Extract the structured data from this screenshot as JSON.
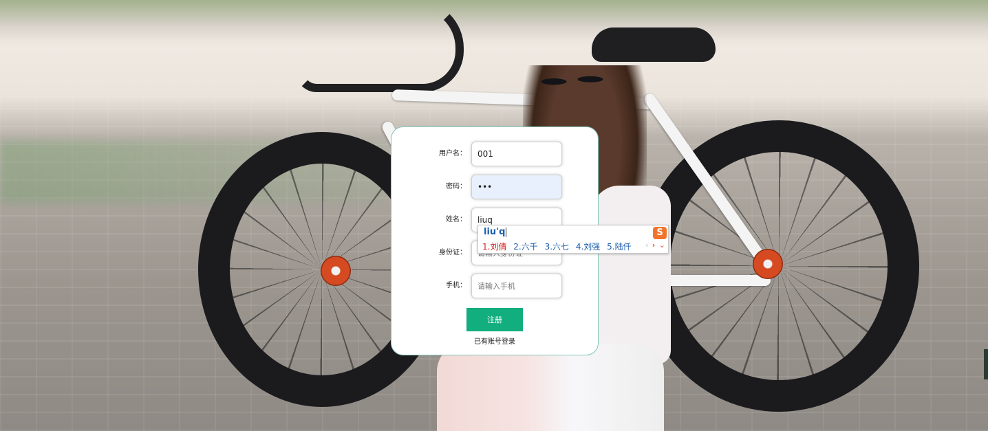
{
  "form": {
    "fields": [
      {
        "label": "用户名：",
        "value": "001",
        "placeholder": ""
      },
      {
        "label": "密码：",
        "value": "•••",
        "placeholder": ""
      },
      {
        "label": "姓名：",
        "value": "liuq",
        "placeholder": ""
      },
      {
        "label": "身份证：",
        "value": "",
        "placeholder": "请输入身份证"
      },
      {
        "label": "手机：",
        "value": "",
        "placeholder": "请输入手机"
      }
    ],
    "submit_label": "注册",
    "login_link": "已有账号登录"
  },
  "ime": {
    "composition": "liu'q",
    "candidates": [
      "1.刘倩",
      "2.六千",
      "3.六七",
      "4.刘强",
      "5.陆仟"
    ],
    "logo": "S",
    "nav": {
      "prev": "‹",
      "next": "›",
      "more": "⌄"
    }
  },
  "colors": {
    "accent": "#12ae7e",
    "card_border": "#7fc7b7",
    "ime_text": "#1c5fae",
    "ime_selected": "#d62020",
    "ime_logo": "#f2742b"
  }
}
